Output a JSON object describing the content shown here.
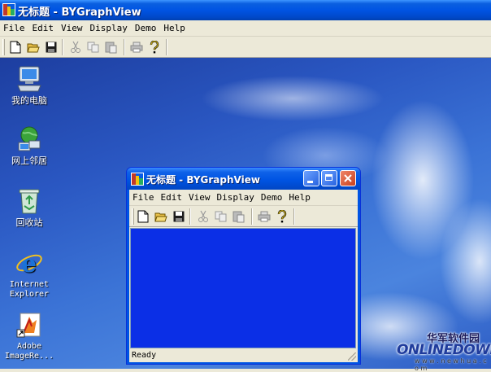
{
  "window": {
    "title": "无标题 - BYGraphView",
    "menu": [
      "File",
      "Edit",
      "View",
      "Display",
      "Demo",
      "Help"
    ],
    "toolbar": [
      "new-icon",
      "open-icon",
      "save-icon",
      "cut-icon",
      "copy-icon",
      "paste-icon",
      "print-icon",
      "help-icon"
    ]
  },
  "desktop": {
    "icons": [
      {
        "label": "我的电脑",
        "icon": "my-computer-icon"
      },
      {
        "label": "网上邻居",
        "icon": "network-places-icon"
      },
      {
        "label": "回收站",
        "icon": "recycle-bin-icon"
      },
      {
        "label": "Internet\nExplorer",
        "icon": "internet-explorer-icon"
      },
      {
        "label": "Adobe\nImageRe...",
        "icon": "adobe-imageready-icon"
      }
    ]
  },
  "inner_window": {
    "title": "无标题 - BYGraphView",
    "menu": [
      "File",
      "Edit",
      "View",
      "Display",
      "Demo",
      "Help"
    ],
    "status": "Ready"
  },
  "watermark": {
    "chinese": "华军软件园",
    "brand": "ONLINEDOWN",
    "url": "w w w . n e w h u a . c o m"
  },
  "colors": {
    "title_bar": "#0054e3",
    "client_area": "#0b2fe6",
    "chrome": "#ece9d8"
  }
}
